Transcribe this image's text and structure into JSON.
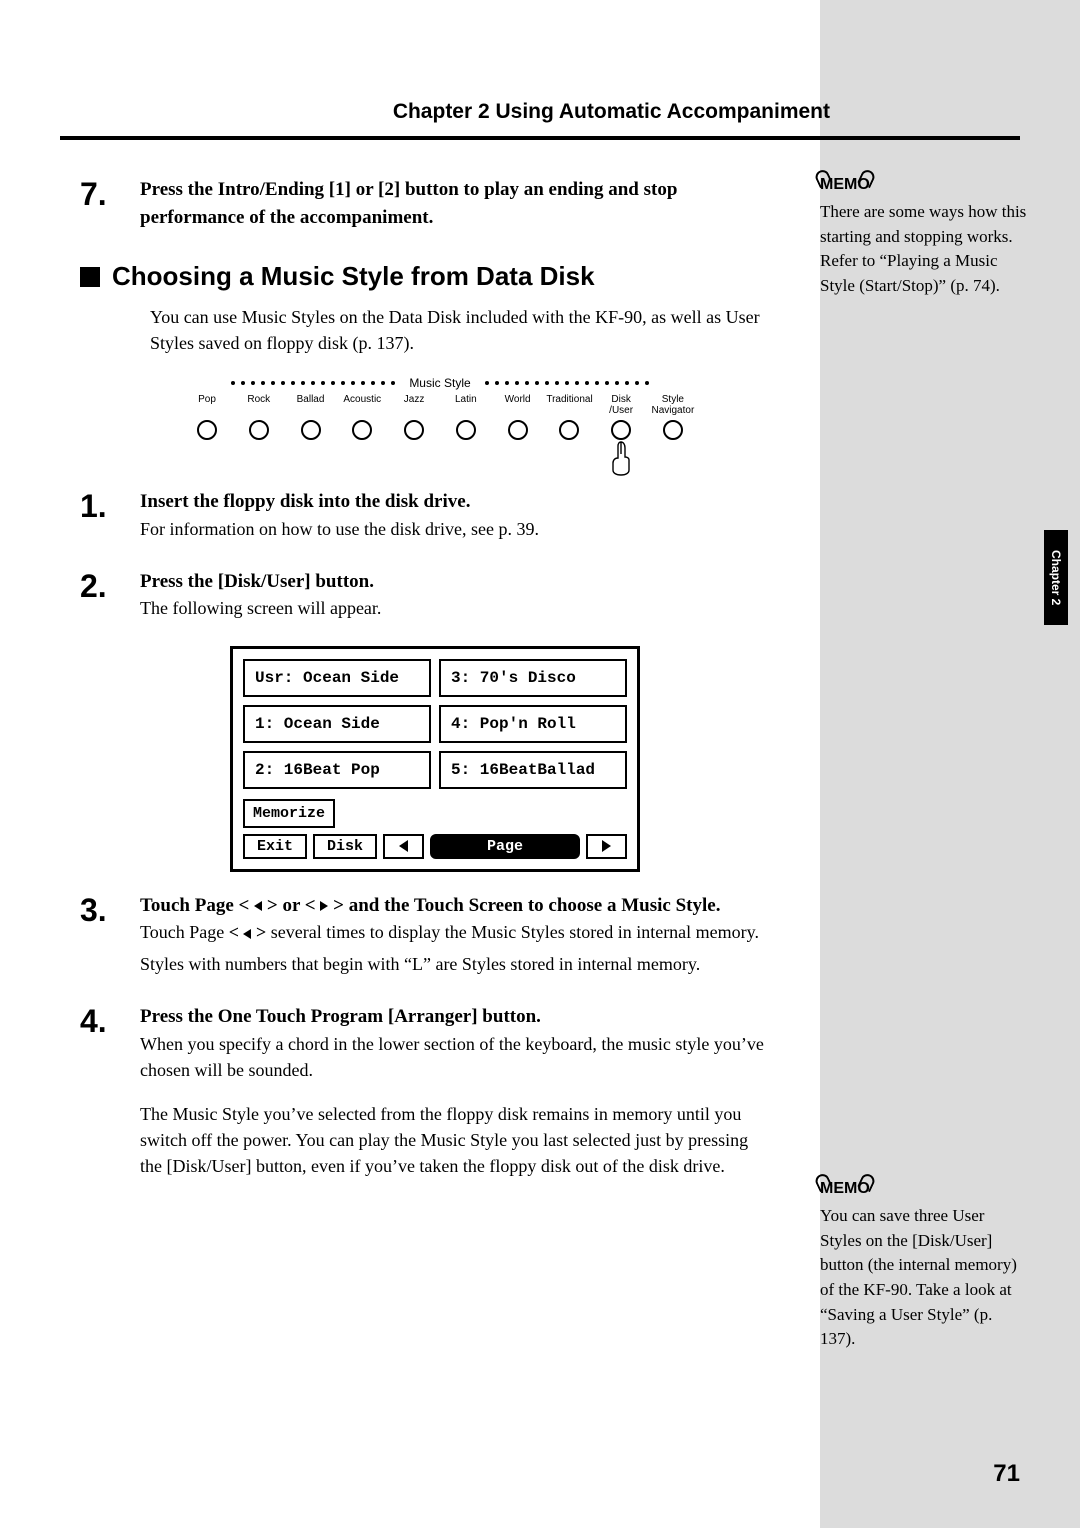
{
  "header": {
    "title": "Chapter 2  Using Automatic Accompaniment"
  },
  "step7": {
    "num": "7.",
    "text": "Press the Intro/Ending [1] or [2] button to play an ending and stop performance of the accompaniment."
  },
  "section": {
    "title": "Choosing a Music Style from Data Disk"
  },
  "intro": "You can use Music Styles on the Data Disk included with the KF-90, as well as User Styles saved on floppy disk (p. 137).",
  "panel": {
    "center": "Music Style",
    "labels": [
      "Pop",
      "Rock",
      "Ballad",
      "Acoustic",
      "Jazz",
      "Latin",
      "World",
      "Traditional",
      "Disk\n/User",
      "Style\nNavigator"
    ]
  },
  "step1": {
    "num": "1.",
    "title": "Insert the floppy disk into the disk drive.",
    "body": "For information on how to use the disk drive, see p. 39."
  },
  "step2": {
    "num": "2.",
    "title": "Press the [Disk/User] button.",
    "body": "The following screen will appear."
  },
  "screen": {
    "cells": [
      "Usr: Ocean Side",
      "3: 70's Disco",
      "1: Ocean Side",
      "4: Pop'n Roll",
      "2: 16Beat Pop",
      "5: 16BeatBallad"
    ],
    "memorize": "Memorize",
    "exit": "Exit",
    "disk": "Disk",
    "page": "Page"
  },
  "step3": {
    "num": "3.",
    "title_pre": "Touch Page < ",
    "title_mid": " > or < ",
    "title_post": " > and the Touch Screen to choose a Music Style.",
    "body1_pre": "Touch Page ",
    "body1_bold_pre": "< ",
    "body1_bold_post": " >",
    "body1_post": " several times to display the Music Styles stored in internal memory.",
    "body2": "Styles with numbers that begin with “L” are Styles stored in internal memory."
  },
  "step4": {
    "num": "4.",
    "title": "Press the One Touch Program [Arranger] button.",
    "body1": "When you specify a chord in the lower section of the keyboard, the music style you’ve chosen will be sounded.",
    "body2": "The Music Style you’ve selected from the floppy disk remains in memory until you switch off the power. You can play the Music Style you last selected just by pressing the [Disk/User] button, even if you’ve taken the floppy disk out of the disk drive."
  },
  "memo1": {
    "label": "MEMO",
    "text": "There are some ways how this starting and stopping works. Refer to “Playing a Music Style (Start/Stop)” (p. 74)."
  },
  "memo2": {
    "label": "MEMO",
    "text": "You can save three User Styles on the [Disk/User] button (the internal memory) of the KF-90. Take a look at “Saving a User Style” (p. 137)."
  },
  "sidetab": "Chapter 2",
  "pagenum": "71"
}
